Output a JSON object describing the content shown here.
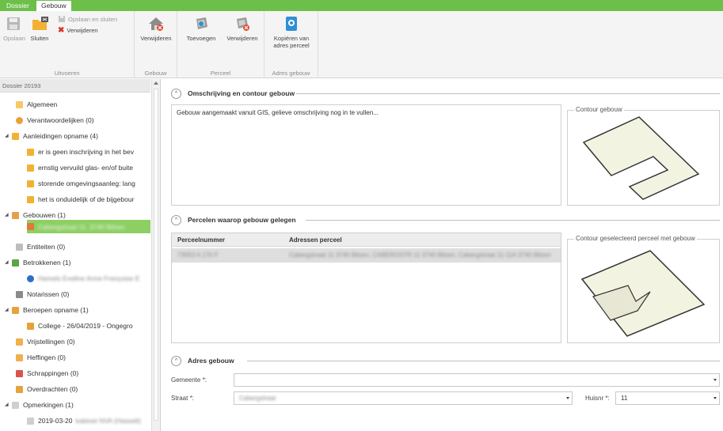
{
  "tabs": [
    {
      "label": "Dossier"
    },
    {
      "label": "Gebouw"
    }
  ],
  "ribbon": {
    "uitvoeren": {
      "title": "Uitvoeren",
      "opslaan": "Opslaan",
      "sluiten": "Sluiten",
      "opslaan_sluiten": "Opslaan en sluiten",
      "verwijderen": "Verwijderen"
    },
    "gebouw": {
      "title": "Gebouw",
      "verwijderen": "Verwijderen"
    },
    "perceel": {
      "title": "Perceel",
      "toevoegen": "Toevoegen",
      "verwijderen": "Verwijderen"
    },
    "adres_gebouw": {
      "title": "Adres gebouw",
      "kopieren_line1": "Kopiëren van",
      "kopieren_line2": "adres perceel"
    }
  },
  "sidebar": {
    "header": "Dossier 20193",
    "items": [
      {
        "label": "Algemeen"
      },
      {
        "label": "Verantwoordelijken (0)"
      },
      {
        "label": "Aanleidingen opname (4)"
      },
      {
        "label": "er is geen inschrijving in het bev"
      },
      {
        "label": "ernstig vervuild glas- en/of buite"
      },
      {
        "label": "storende omgevingsaanleg: lang"
      },
      {
        "label": "het is onduidelijk of de bijgebour"
      },
      {
        "label": "Gebouwen (1)"
      },
      {
        "label": "Cabergstraat 11, 3740 Bilzen"
      },
      {
        "label": "Entiteiten (0)"
      },
      {
        "label": "Betrokkenen (1)"
      },
      {
        "label": "Hamels Eveline Anne Françoise E"
      },
      {
        "label": "Notarissen (0)"
      },
      {
        "label": "Beroepen opname (1)"
      },
      {
        "label": "College - 26/04/2019 - Ongegro"
      },
      {
        "label": "Vrijstellingen (0)"
      },
      {
        "label": "Heffingen (0)"
      },
      {
        "label": "Schrappingen (0)"
      },
      {
        "label": "Overdrachten (0)"
      },
      {
        "label": "Opmerkingen (1)"
      },
      {
        "label": "2019-03-20"
      },
      {
        "label": "kabinet NVA (Hasselt)"
      }
    ],
    "expanders": {
      "open": "◢"
    }
  },
  "omschrijving": {
    "title": "Omschrijving en contour gebouw",
    "text": "Gebouw aangemaakt vanuit GIS, gelieve omschrijving nog in te vullen...",
    "contour_legend": "Contour gebouw"
  },
  "percelen": {
    "title": "Percelen waarop gebouw gelegen",
    "columns": [
      "Perceelnummer",
      "Adressen perceel"
    ],
    "rows": [
      {
        "nummer": "73053 A 170 F",
        "adressen": "Cabergstraat 11 3740 Bilzen, CABERGSTR 11 3740 Bilzen, Cabergstraat 11-11A 3740 Bilzen"
      }
    ],
    "contour_legend": "Contour geselecteerd perceel met gebouw"
  },
  "adres": {
    "title": "Adres gebouw",
    "gemeente_label": "Gemeente *:",
    "gemeente_value": "",
    "straat_label": "Straat *:",
    "straat_value": "Cabergstraat",
    "huisnr_label": "Huisnr *:",
    "huisnr_value": "11"
  },
  "colors": {
    "accent": "#6cbf48",
    "selection": "#8ecf64"
  },
  "icons": {
    "collapse": "^"
  }
}
